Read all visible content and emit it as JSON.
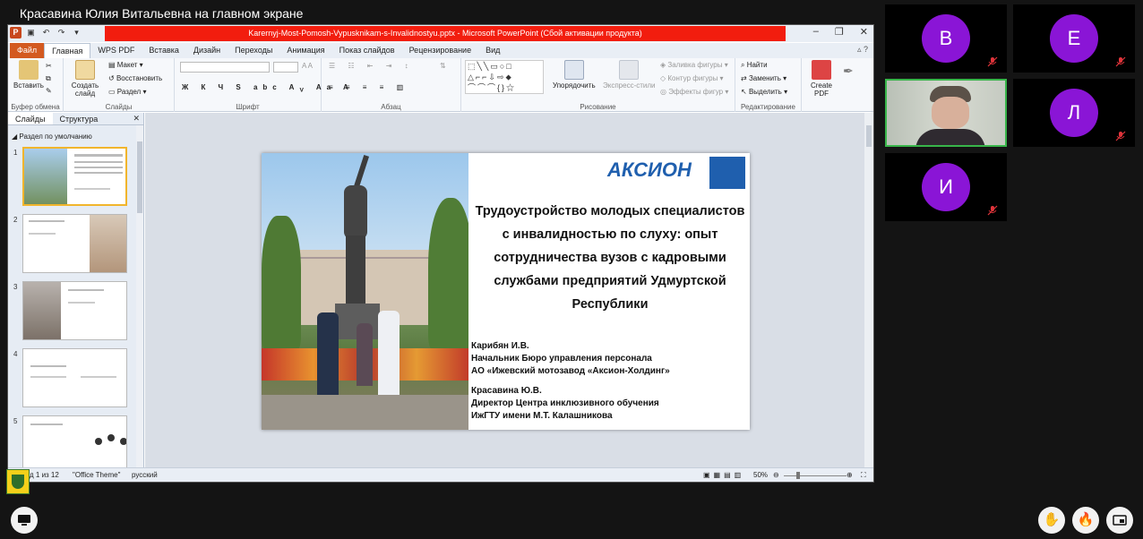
{
  "share_banner": "Красавина Юлия Витальевна на главном экране",
  "ppt": {
    "window_title": "Karernyj-Most-Pomosh-Vypusknikam-s-Invalidnostyu.pptx - Microsoft PowerPoint (Сбой активации продукта)",
    "tabs": [
      "Файл",
      "Главная",
      "WPS PDF",
      "Вставка",
      "Дизайн",
      "Переходы",
      "Анимация",
      "Показ слайдов",
      "Рецензирование",
      "Вид"
    ],
    "ribbon": {
      "paste": "Вставить",
      "clipboard_group": "Буфер обмена",
      "new_slide": "Создать слайд",
      "layout": "Макет",
      "reset": "Восстановить",
      "section": "Раздел",
      "slides_group": "Слайды",
      "font_group": "Шрифт",
      "paragraph_group": "Абзац",
      "arrange": "Упорядочить",
      "quick_styles": "Экспресс-стили",
      "shape_fill": "Заливка фигуры",
      "shape_outline": "Контур фигуры",
      "shape_effects": "Эффекты фигур",
      "drawing_group": "Рисование",
      "find": "Найти",
      "replace": "Заменить",
      "select": "Выделить",
      "editing_group": "Редактирование",
      "create_pdf": "Create PDF"
    },
    "pane": {
      "tab_slides": "Слайды",
      "tab_outline": "Структура",
      "section_default": "Раздел по умолчанию",
      "thumb_numbers": [
        "1",
        "2",
        "3",
        "4",
        "5"
      ]
    },
    "slide": {
      "logo_text": "АКСИОН",
      "title": "Трудоустройство молодых специалистов с инвалидностью по слуху: опыт сотрудничества вузов с кадровыми службами предприятий Удмуртской Республики",
      "author1_name": "Карибян И.В.",
      "author1_role": "Начальник Бюро управления персонала",
      "author1_org": "АО «Ижевский мотозавод «Аксион-Холдинг»",
      "author2_name": "Красавина Ю.В.",
      "author2_role": "Директор Центра инклюзивного обучения",
      "author2_org": "ИжГТУ имени М.Т. Калашникова"
    },
    "status": {
      "slide_counter": "д 1 из 12",
      "theme": "\"Office Theme\"",
      "language": "русский",
      "zoom": "50%"
    }
  },
  "participants": [
    {
      "initial": "В",
      "muted": true
    },
    {
      "initial": "Е",
      "muted": true
    },
    {
      "initial": "Л",
      "muted": true
    },
    {
      "initial": "И",
      "muted": true
    }
  ],
  "colors": {
    "avatar": "#8a15d6",
    "active_speaker": "#38b54a",
    "title_red": "#f21d0e"
  }
}
